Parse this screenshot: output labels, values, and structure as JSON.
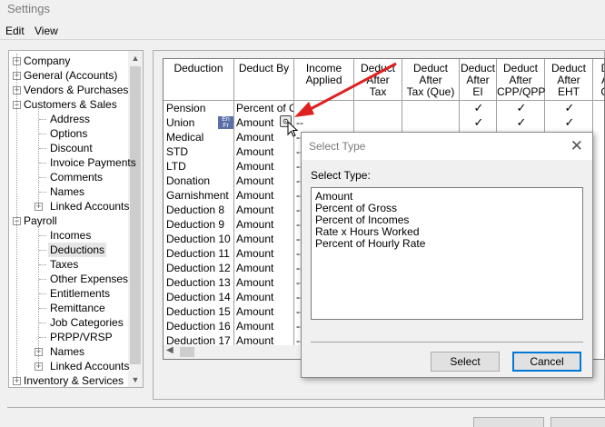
{
  "window": {
    "title": "Settings"
  },
  "menu": {
    "items": [
      "Edit",
      "View"
    ]
  },
  "tree": {
    "items": [
      {
        "label": "Company",
        "level": 0,
        "expander": "+"
      },
      {
        "label": "General (Accounts)",
        "level": 0,
        "expander": "+"
      },
      {
        "label": "Vendors & Purchases",
        "level": 0,
        "expander": "+"
      },
      {
        "label": "Customers & Sales",
        "level": 0,
        "expander": "-"
      },
      {
        "label": "Address",
        "level": 1,
        "expander": ""
      },
      {
        "label": "Options",
        "level": 1,
        "expander": ""
      },
      {
        "label": "Discount",
        "level": 1,
        "expander": ""
      },
      {
        "label": "Invoice Payments",
        "level": 1,
        "expander": ""
      },
      {
        "label": "Comments",
        "level": 1,
        "expander": ""
      },
      {
        "label": "Names",
        "level": 1,
        "expander": ""
      },
      {
        "label": "Linked Accounts",
        "level": 1,
        "expander": "+"
      },
      {
        "label": "Payroll",
        "level": 0,
        "expander": "-"
      },
      {
        "label": "Incomes",
        "level": 1,
        "expander": ""
      },
      {
        "label": "Deductions",
        "level": 1,
        "expander": "",
        "selected": true
      },
      {
        "label": "Taxes",
        "level": 1,
        "expander": ""
      },
      {
        "label": "Other Expenses",
        "level": 1,
        "expander": ""
      },
      {
        "label": "Entitlements",
        "level": 1,
        "expander": ""
      },
      {
        "label": "Remittance",
        "level": 1,
        "expander": ""
      },
      {
        "label": "Job Categories",
        "level": 1,
        "expander": ""
      },
      {
        "label": "PRPP/VRSP",
        "level": 1,
        "expander": ""
      },
      {
        "label": "Names",
        "level": 1,
        "expander": "+"
      },
      {
        "label": "Linked Accounts",
        "level": 1,
        "expander": "+"
      },
      {
        "label": "Inventory & Services",
        "level": 0,
        "expander": "+"
      }
    ]
  },
  "grid": {
    "headers": [
      "Deduction",
      "Deduct By",
      "Income\nApplied",
      "Deduct\nAfter\nTax",
      "Deduct\nAfter\nTax (Que)",
      "Deduct\nAfter\nEI",
      "Deduct\nAfter\nCPP/QPP",
      "Deduct\nAfter\nEHT",
      "D\nA\nQ"
    ],
    "rows": [
      {
        "name": "Pension",
        "deduct_by": "Percent of Gross",
        "income": "",
        "checks": [
          false,
          false,
          true,
          true,
          true
        ]
      },
      {
        "name": "Union",
        "deduct_by": "Amount",
        "income": "--",
        "checks": [
          false,
          false,
          true,
          true,
          true
        ]
      },
      {
        "name": "Medical",
        "deduct_by": "Amount",
        "income": "--",
        "checks": []
      },
      {
        "name": "STD",
        "deduct_by": "Amount",
        "income": "--",
        "checks": []
      },
      {
        "name": "LTD",
        "deduct_by": "Amount",
        "income": "--",
        "checks": []
      },
      {
        "name": "Donation",
        "deduct_by": "Amount",
        "income": "--",
        "checks": []
      },
      {
        "name": "Garnishment",
        "deduct_by": "Amount",
        "income": "--",
        "checks": []
      },
      {
        "name": "Deduction 8",
        "deduct_by": "Amount",
        "income": "--",
        "checks": []
      },
      {
        "name": "Deduction 9",
        "deduct_by": "Amount",
        "income": "--",
        "checks": []
      },
      {
        "name": "Deduction 10",
        "deduct_by": "Amount",
        "income": "--",
        "checks": []
      },
      {
        "name": "Deduction 11",
        "deduct_by": "Amount",
        "income": "--",
        "checks": []
      },
      {
        "name": "Deduction 12",
        "deduct_by": "Amount",
        "income": "--",
        "checks": []
      },
      {
        "name": "Deduction 13",
        "deduct_by": "Amount",
        "income": "--",
        "checks": []
      },
      {
        "name": "Deduction 14",
        "deduct_by": "Amount",
        "income": "--",
        "checks": []
      },
      {
        "name": "Deduction 15",
        "deduct_by": "Amount",
        "income": "--",
        "checks": []
      },
      {
        "name": "Deduction 16",
        "deduct_by": "Amount",
        "income": "--",
        "checks": []
      },
      {
        "name": "Deduction 17",
        "deduct_by": "Amount",
        "income": "--",
        "checks": []
      }
    ],
    "badge_text": "En\nFr",
    "check_glyph": "✓"
  },
  "dialog": {
    "title": "Select Type",
    "label": "Select Type:",
    "options": [
      "Amount",
      "Percent of Gross",
      "Percent of Incomes",
      "Rate x Hours Worked",
      "Percent of Hourly Rate"
    ],
    "select_button": "Select",
    "cancel_button": "Cancel",
    "close_glyph": "✕"
  },
  "colors": {
    "annotation_arrow": "#e02020",
    "selection": "#e5e5e5",
    "default_button_border": "#0078d7"
  }
}
